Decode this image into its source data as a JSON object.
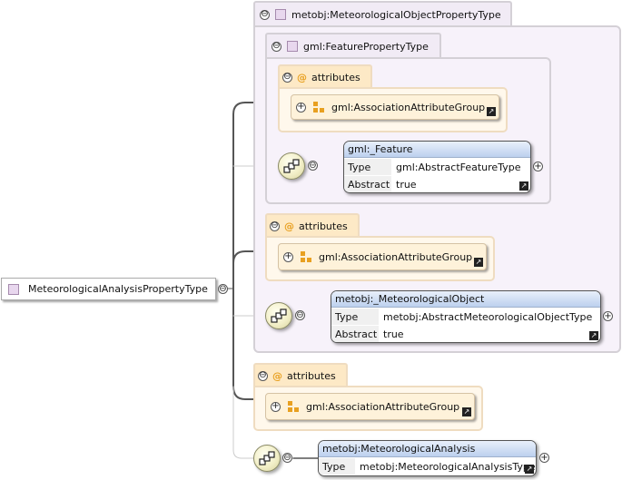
{
  "root": {
    "label": "MeteorologicalAnalysisPropertyType"
  },
  "outer_type": {
    "label": "metobj:MeteorologicalObjectPropertyType"
  },
  "inner_type": {
    "label": "gml:FeaturePropertyType"
  },
  "attributes_label": "attributes",
  "attribute_group": "gml:AssociationAttributeGroup",
  "at_symbol": "@",
  "toggle_minus": "⊖",
  "toggle_plus": "+",
  "feature_element": {
    "name": "gml:_Feature",
    "rows": [
      {
        "key": "Type",
        "value": "gml:AbstractFeatureType"
      },
      {
        "key": "Abstract",
        "value": "true"
      }
    ]
  },
  "metobj_element": {
    "name": "metobj:_MeteorologicalObject",
    "rows": [
      {
        "key": "Type",
        "value": "metobj:AbstractMeteorologicalObjectType"
      },
      {
        "key": "Abstract",
        "value": "true"
      }
    ]
  },
  "analysis_element": {
    "name": "metobj:MeteorologicalAnalysis",
    "rows": [
      {
        "key": "Type",
        "value": "metobj:MeteorologicalAnalysisType"
      }
    ]
  },
  "colors": {
    "complex_type_bg": "#f7f2fa",
    "attribute_bg": "#fff8ec",
    "element_header": "#bcd0ee",
    "connector": "#555555"
  }
}
